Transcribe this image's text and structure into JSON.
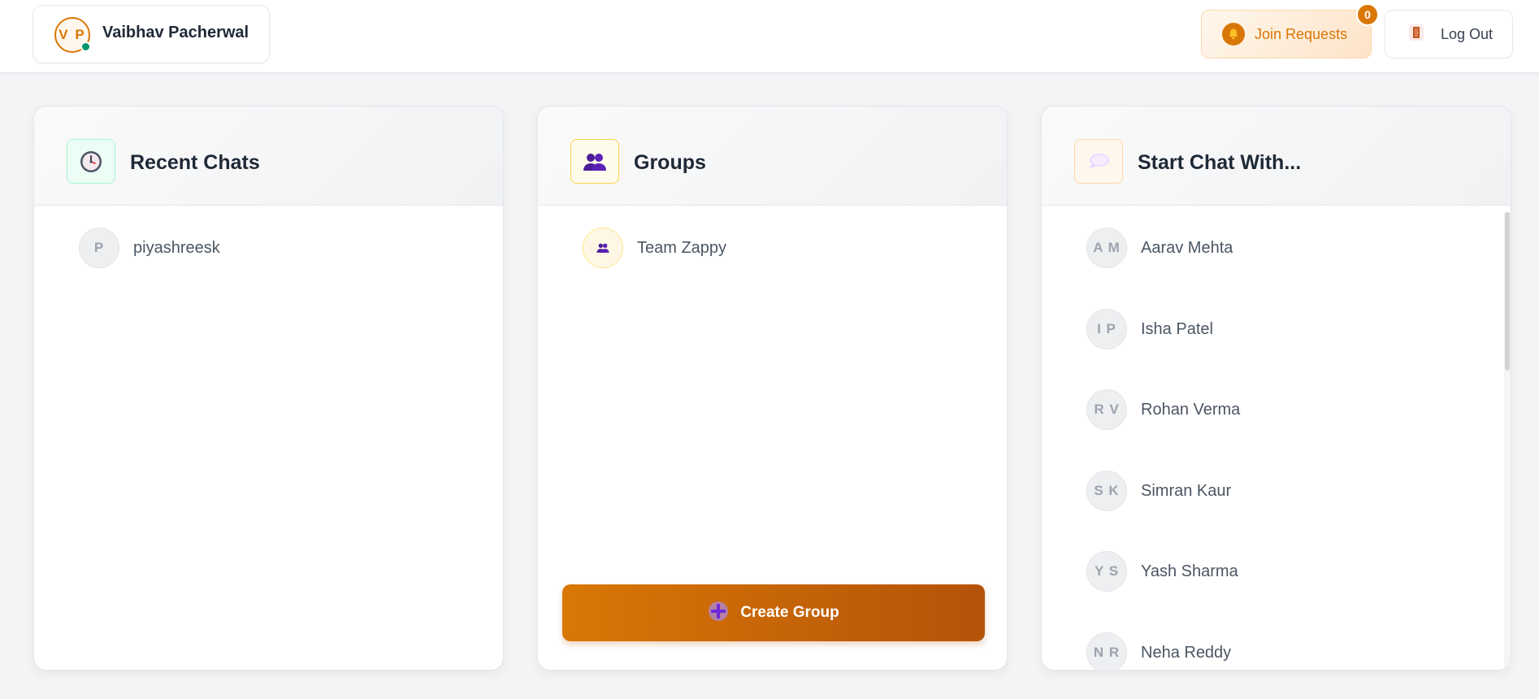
{
  "header": {
    "user": {
      "initials": "V P",
      "name": "Vaibhav Pacherwal",
      "status": "online"
    },
    "join_requests": {
      "label": "Join Requests",
      "count": "0"
    },
    "logout": {
      "label": "Log Out"
    }
  },
  "recent_chats": {
    "title": "Recent Chats",
    "icon": "clock-icon",
    "items": [
      {
        "initials": "P",
        "name": "piyashreesk"
      }
    ]
  },
  "groups": {
    "title": "Groups",
    "icon": "group-icon",
    "items": [
      {
        "icon": "group-icon",
        "name": "Team Zappy"
      }
    ],
    "create_button": {
      "label": "Create Group",
      "icon": "plus-icon"
    }
  },
  "start_chat": {
    "title": "Start Chat With...",
    "icon": "speech-bubble-icon",
    "items": [
      {
        "initials": "A M",
        "name": "Aarav Mehta"
      },
      {
        "initials": "I P",
        "name": "Isha Patel"
      },
      {
        "initials": "R V",
        "name": "Rohan Verma"
      },
      {
        "initials": "S K",
        "name": "Simran Kaur"
      },
      {
        "initials": "Y S",
        "name": "Yash Sharma"
      },
      {
        "initials": "N R",
        "name": "Neha Reddy"
      }
    ]
  },
  "colors": {
    "accent": "#d97706",
    "accent_dark": "#b45309",
    "online": "#059669",
    "background": "#f3f4f6"
  }
}
